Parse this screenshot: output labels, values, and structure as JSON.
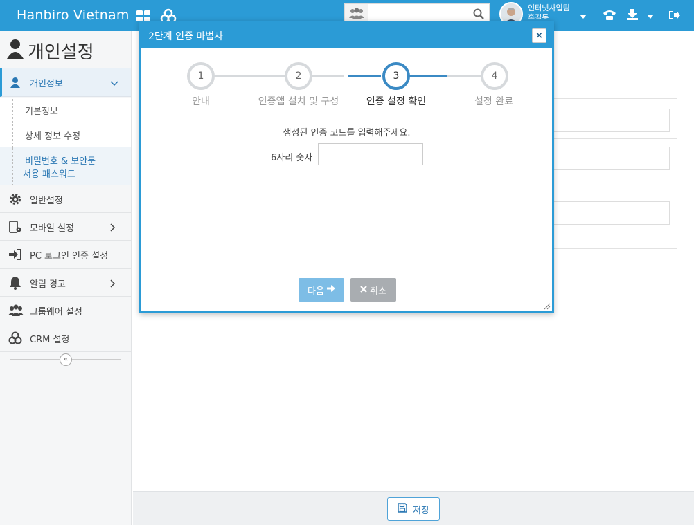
{
  "header": {
    "brand": "Hanbiro Vietnam",
    "search_placeholder": "",
    "user_line1": "인터넷사업팀",
    "user_line2": "홍길동"
  },
  "sidebar": {
    "title": "개인설정",
    "active_section": "개인정보",
    "sub_items": [
      "기본정보",
      "상세 정보 수정",
      "비밀번호 & 보안문",
      "서용 패스워드"
    ],
    "items": [
      "일반설정",
      "모바일 설정",
      "PC 로그인 인증 설정",
      "알림 경고",
      "그룹웨어 설정",
      "CRM 설정"
    ]
  },
  "footer": {
    "save_label": "저장"
  },
  "modal": {
    "title": "2단계 인증 마법사",
    "close": "×",
    "steps": [
      {
        "num": "1",
        "label": "안내"
      },
      {
        "num": "2",
        "label": "인증앱 설치 및 구성"
      },
      {
        "num": "3",
        "label": "인증 설정 확인"
      },
      {
        "num": "4",
        "label": "설정 완료"
      }
    ],
    "instruction": "생성된 인증 코드를 입력해주세요.",
    "code_label": "6자리 숫자",
    "code_value": "",
    "next_label": "다음",
    "cancel_label": "취소"
  },
  "colors": {
    "accent": "#2b9bd6",
    "step_active": "#3b8ac4",
    "step_inactive": "#d6d9dc"
  }
}
